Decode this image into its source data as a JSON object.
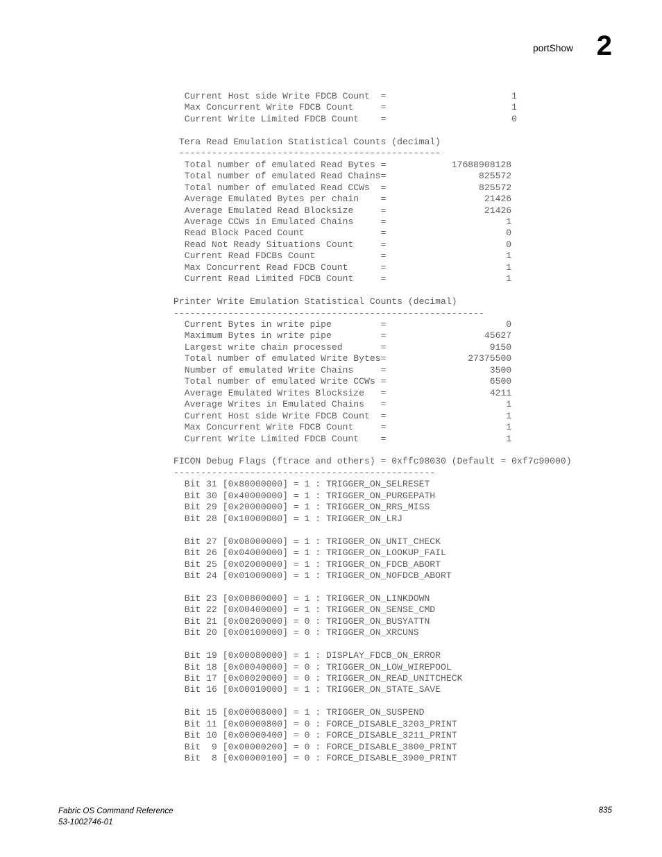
{
  "header": {
    "title": "portShow",
    "chapter": "2"
  },
  "footer": {
    "book_title": "Fabric OS Command Reference",
    "document_number": "53-1002746-01",
    "page_number": "835"
  },
  "listing": {
    "lines": [
      "  Current Host side Write FDCB Count  =                       1",
      "  Max Concurrent Write FDCB Count     =                       1",
      "  Current Write Limited FDCB Count    =                       0",
      "",
      " Tera Read Emulation Statistical Counts (decimal)",
      " ------------------------------------------------",
      "  Total number of emulated Read Bytes =            17688908128",
      "  Total number of emulated Read Chains=                 825572",
      "  Total number of emulated Read CCWs  =                 825572",
      "  Average Emulated Bytes per chain    =                  21426",
      "  Average Emulated Read Blocksize     =                  21426",
      "  Average CCWs in Emulated Chains     =                      1",
      "  Read Block Paced Count              =                      0",
      "  Read Not Ready Situations Count     =                      0",
      "  Current Read FDCBs Count            =                      1",
      "  Max Concurrent Read FDCB Count      =                      1",
      "  Current Read Limited FDCB Count     =                      1",
      "",
      "Printer Write Emulation Statistical Counts (decimal)",
      "---------------------------------------------------------",
      "  Current Bytes in write pipe         =                      0",
      "  Maximum Bytes in write pipe         =                  45627",
      "  Largest write chain processed       =                   9150",
      "  Total number of emulated Write Bytes=               27375500",
      "  Number of emulated Write Chains     =                   3500",
      "  Total number of emulated Write CCWs =                   6500",
      "  Average Emulated Writes Blocksize   =                   4211",
      "  Average Writes in Emulated Chains   =                      1",
      "  Current Host side Write FDCB Count  =                      1",
      "  Max Concurrent Write FDCB Count     =                      1",
      "  Current Write Limited FDCB Count    =                      1",
      "",
      "FICON Debug Flags (ftrace and others) = 0xffc98030 (Default = 0xf7c90000)",
      "------------------------------------------------",
      "  Bit 31 [0x80000000] = 1 : TRIGGER_ON_SELRESET",
      "  Bit 30 [0x40000000] = 1 : TRIGGER_ON_PURGEPATH",
      "  Bit 29 [0x20000000] = 1 : TRIGGER_ON_RRS_MISS",
      "  Bit 28 [0x10000000] = 1 : TRIGGER_ON_LRJ",
      "",
      "  Bit 27 [0x08000000] = 1 : TRIGGER_ON_UNIT_CHECK",
      "  Bit 26 [0x04000000] = 1 : TRIGGER_ON_LOOKUP_FAIL",
      "  Bit 25 [0x02000000] = 1 : TRIGGER_ON_FDCB_ABORT",
      "  Bit 24 [0x01000000] = 1 : TRIGGER_ON_NOFDCB_ABORT",
      "",
      "  Bit 23 [0x00800000] = 1 : TRIGGER_ON_LINKDOWN",
      "  Bit 22 [0x00400000] = 1 : TRIGGER_ON_SENSE_CMD",
      "  Bit 21 [0x00200000] = 0 : TRIGGER_ON_BUSYATTN",
      "  Bit 20 [0x00100000] = 0 : TRIGGER_ON_XRCUNS",
      "",
      "  Bit 19 [0x00080000] = 1 : DISPLAY_FDCB_ON_ERROR",
      "  Bit 18 [0x00040000] = 0 : TRIGGER_ON_LOW_WIREPOOL",
      "  Bit 17 [0x00020000] = 0 : TRIGGER_ON_READ_UNITCHECK",
      "  Bit 16 [0x00010000] = 1 : TRIGGER_ON_STATE_SAVE",
      "",
      "  Bit 15 [0x00008000] = 1 : TRIGGER_ON_SUSPEND",
      "  Bit 11 [0x00000800] = 0 : FORCE_DISABLE_3203_PRINT",
      "  Bit 10 [0x00000400] = 0 : FORCE_DISABLE_3211_PRINT",
      "  Bit  9 [0x00000200] = 0 : FORCE_DISABLE_3800_PRINT",
      "  Bit  8 [0x00000100] = 0 : FORCE_DISABLE_3900_PRINT"
    ]
  }
}
